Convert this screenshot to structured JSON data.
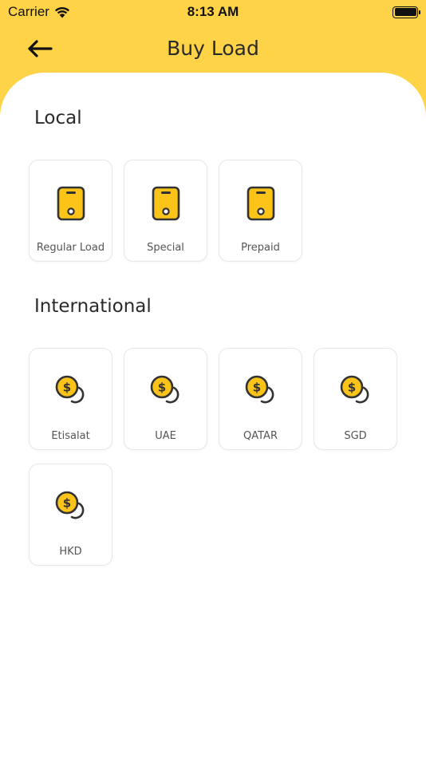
{
  "status_bar": {
    "carrier": "Carrier",
    "time": "8:13 AM"
  },
  "header": {
    "title": "Buy Load",
    "back_icon": "arrow-left-icon"
  },
  "colors": {
    "accent": "#fed347",
    "icon_fill": "#fcc419",
    "icon_stroke": "#333333"
  },
  "sections": {
    "local": {
      "title": "Local",
      "items": [
        {
          "label": "Regular Load",
          "icon": "phone-icon"
        },
        {
          "label": "Special",
          "icon": "phone-icon"
        },
        {
          "label": "Prepaid",
          "icon": "phone-icon"
        }
      ]
    },
    "international": {
      "title": "International",
      "items": [
        {
          "label": "Etisalat",
          "icon": "coin-icon"
        },
        {
          "label": "UAE",
          "icon": "coin-icon"
        },
        {
          "label": "QATAR",
          "icon": "coin-icon"
        },
        {
          "label": "SGD",
          "icon": "coin-icon"
        },
        {
          "label": "HKD",
          "icon": "coin-icon"
        }
      ]
    }
  }
}
